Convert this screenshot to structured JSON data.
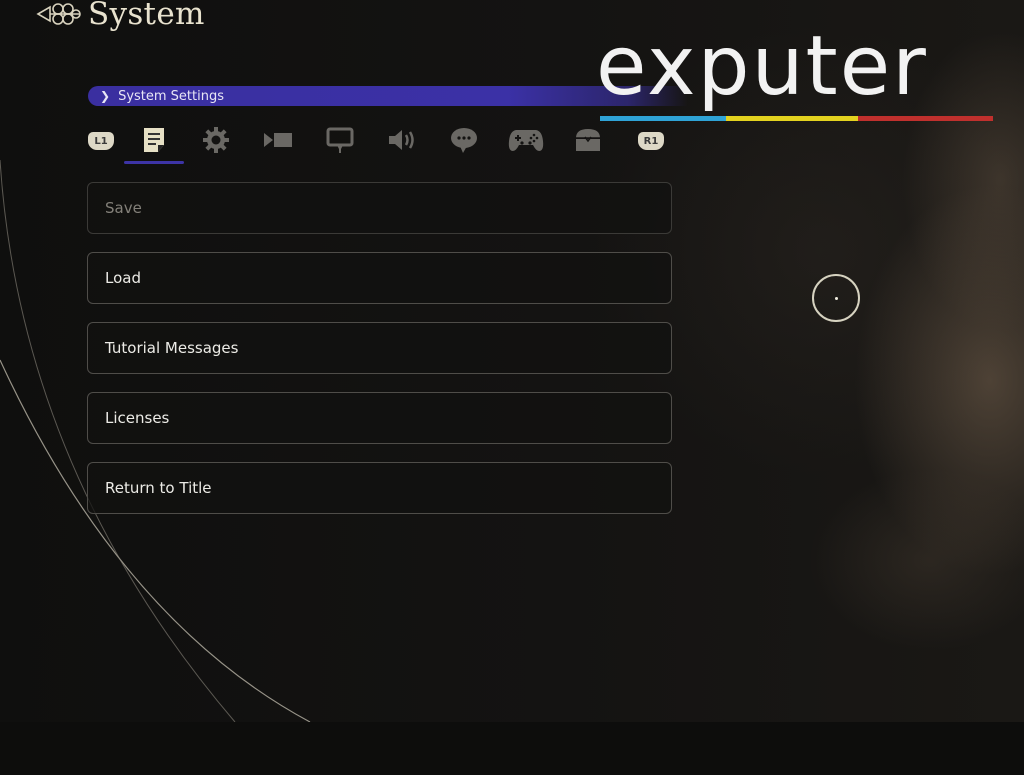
{
  "header": {
    "title": "System",
    "ornament_icon": "knot-ornament-icon"
  },
  "breadcrumb": {
    "chevron": "❯",
    "label": "System Settings",
    "color": "#3b31a6"
  },
  "tabs": {
    "left_bumper": "L1",
    "right_bumper": "R1",
    "items": [
      {
        "icon": "document-icon",
        "active": true
      },
      {
        "icon": "gear-icon",
        "active": false
      },
      {
        "icon": "camera-icon",
        "active": false
      },
      {
        "icon": "monitor-icon",
        "active": false
      },
      {
        "icon": "speaker-icon",
        "active": false
      },
      {
        "icon": "chat-bubble-icon",
        "active": false
      },
      {
        "icon": "gamepad-icon",
        "active": false
      },
      {
        "icon": "treasure-chest-icon",
        "active": false
      }
    ]
  },
  "menu": {
    "items": [
      {
        "label": "Save",
        "enabled": false
      },
      {
        "label": "Load",
        "enabled": true
      },
      {
        "label": "Tutorial Messages",
        "enabled": true
      },
      {
        "label": "Licenses",
        "enabled": true
      },
      {
        "label": "Return to Title",
        "enabled": true
      }
    ]
  },
  "watermark": {
    "text": "exputer",
    "stripe_colors": [
      "#2fa3d6",
      "#e3d21f",
      "#c0302d"
    ]
  }
}
